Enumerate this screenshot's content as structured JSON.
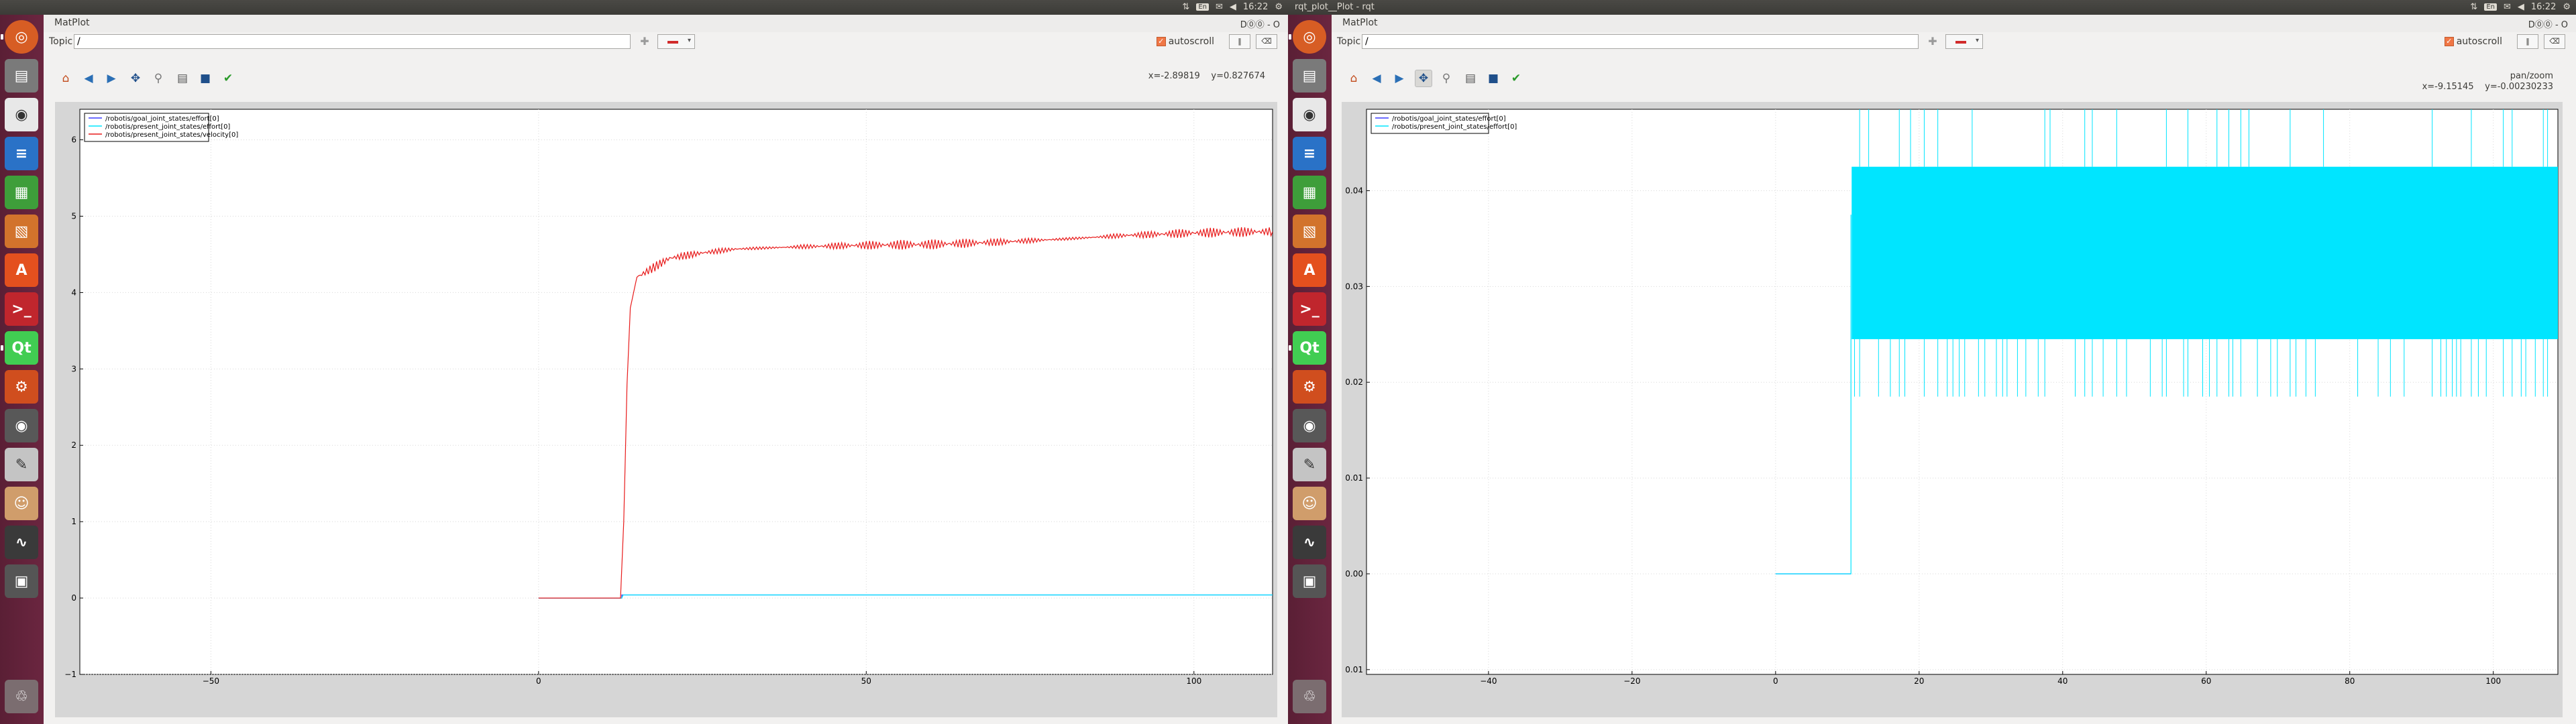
{
  "left": {
    "topbar": {
      "title": "",
      "kbd": "En",
      "time": "16:22"
    },
    "panel_title": "MatPlot",
    "panel_controls": "D⓪⓪ - O",
    "topic_label": "Topic",
    "topic_value": "/",
    "autoscroll_label": "autoscroll",
    "coords": {
      "x": "x=-2.89819",
      "y": "y=0.827674",
      "mode": ""
    },
    "chart_data": {
      "type": "line",
      "xlim": [
        -70,
        112
      ],
      "ylim": [
        -1,
        6.4
      ],
      "xticks": [
        "−50",
        "0",
        "50",
        "100"
      ],
      "xtick_values": [
        -50,
        0,
        50,
        100
      ],
      "yticks": [
        "−1",
        "0",
        "1",
        "2",
        "3",
        "4",
        "5",
        "6"
      ],
      "ytick_values": [
        -1,
        0,
        1,
        2,
        3,
        4,
        5,
        6
      ],
      "grid": true,
      "legend_position": "top-left",
      "series": [
        {
          "name": "/robotis/goal_joint_states/effort[0]",
          "color": "#3a3aff",
          "points": [
            [
              0,
              0
            ],
            [
              12.7,
              0
            ],
            [
              12.7,
              0.04
            ],
            [
              112,
              0.04
            ]
          ]
        },
        {
          "name": "/robotis/present_joint_states/effort[0]",
          "color": "#00e5ff",
          "points": [
            [
              0,
              0
            ],
            [
              12.7,
              0
            ],
            [
              12.9,
              0.04
            ],
            [
              112,
              0.04
            ]
          ]
        },
        {
          "name": "/robotis/present_joint_states/velocity[0]",
          "color": "#e81b1b",
          "points": [
            [
              0,
              0
            ],
            [
              12.5,
              0
            ],
            [
              13.0,
              1.0
            ],
            [
              13.5,
              2.8
            ],
            [
              14.0,
              3.8
            ],
            [
              15.0,
              4.2
            ],
            [
              17,
              4.3
            ],
            [
              20,
              4.45
            ],
            [
              25,
              4.52
            ],
            [
              30,
              4.57
            ],
            [
              40,
              4.6
            ],
            [
              50,
              4.62
            ],
            [
              60,
              4.63
            ],
            [
              70,
              4.66
            ],
            [
              80,
              4.7
            ],
            [
              90,
              4.75
            ],
            [
              100,
              4.78
            ],
            [
              112,
              4.8
            ]
          ],
          "noise": 0.04
        }
      ]
    }
  },
  "right": {
    "topbar": {
      "title": "rqt_plot__Plot - rqt",
      "kbd": "En",
      "time": "16:22"
    },
    "panel_title": "MatPlot",
    "panel_controls": "D⓪⓪ - O",
    "topic_label": "Topic",
    "topic_value": "/",
    "autoscroll_label": "autoscroll",
    "coords": {
      "x": "x=-9.15145",
      "y": "y=-0.00230233",
      "mode": "pan/zoom"
    },
    "chart_data": {
      "type": "line",
      "xlim": [
        -57,
        109
      ],
      "ylim": [
        -0.0105,
        0.0485
      ],
      "xticks": [
        "−40",
        "−20",
        "0",
        "20",
        "40",
        "60",
        "80",
        "100"
      ],
      "xtick_values": [
        -40,
        -20,
        0,
        20,
        40,
        60,
        80,
        100
      ],
      "yticks": [
        "0.01",
        "0.00",
        "0.01",
        "0.02",
        "0.03",
        "0.04"
      ],
      "ytick_values": [
        -0.01,
        0,
        0.01,
        0.02,
        0.03,
        0.04
      ],
      "grid": true,
      "legend_position": "top-left",
      "series": [
        {
          "name": "/robotis/goal_joint_states/effort[0]",
          "color": "#3a3aff",
          "points": [
            [
              0,
              0
            ],
            [
              10.5,
              0
            ]
          ]
        },
        {
          "name": "/robotis/present_joint_states/effort[0]",
          "color": "#00e5ff",
          "points": [
            [
              0,
              0
            ],
            [
              10.5,
              0
            ],
            [
              10.5,
              0.0375
            ]
          ],
          "band": {
            "x_start": 10.6,
            "x_end": 109,
            "low": 0.0245,
            "high": 0.0425,
            "spike_high": 0.0485,
            "spike_low": 0.0185
          }
        }
      ]
    }
  },
  "launcher": {
    "icons": [
      "ubuntu-dash-icon",
      "files-icon",
      "chrome-icon",
      "writer-icon",
      "calc-icon",
      "impress-icon",
      "software-center-icon",
      "terminal-icon",
      "qt-creator-icon",
      "system-settings-icon",
      "eye-icon",
      "text-editor-icon",
      "user-icon",
      "system-monitor-icon",
      "workspace-switcher-icon"
    ],
    "colors": [
      "#d75d24",
      "#7a7a7a",
      "#e8e8e8",
      "#2a72c7",
      "#3e9e3a",
      "#d2732c",
      "#e4501e",
      "#c0262d",
      "#41cd52",
      "#d04e1e",
      "#585858",
      "#c4c4c4",
      "#d09d6b",
      "#3a3a3a",
      "#555555"
    ],
    "glyphs": [
      "◎",
      "▤",
      "◉",
      "≡",
      "▦",
      "▧",
      "A",
      ">_",
      "Qt",
      "⚙",
      "◉",
      "✎",
      "☺",
      "∿",
      "▣"
    ]
  },
  "trash_glyph": "♲"
}
